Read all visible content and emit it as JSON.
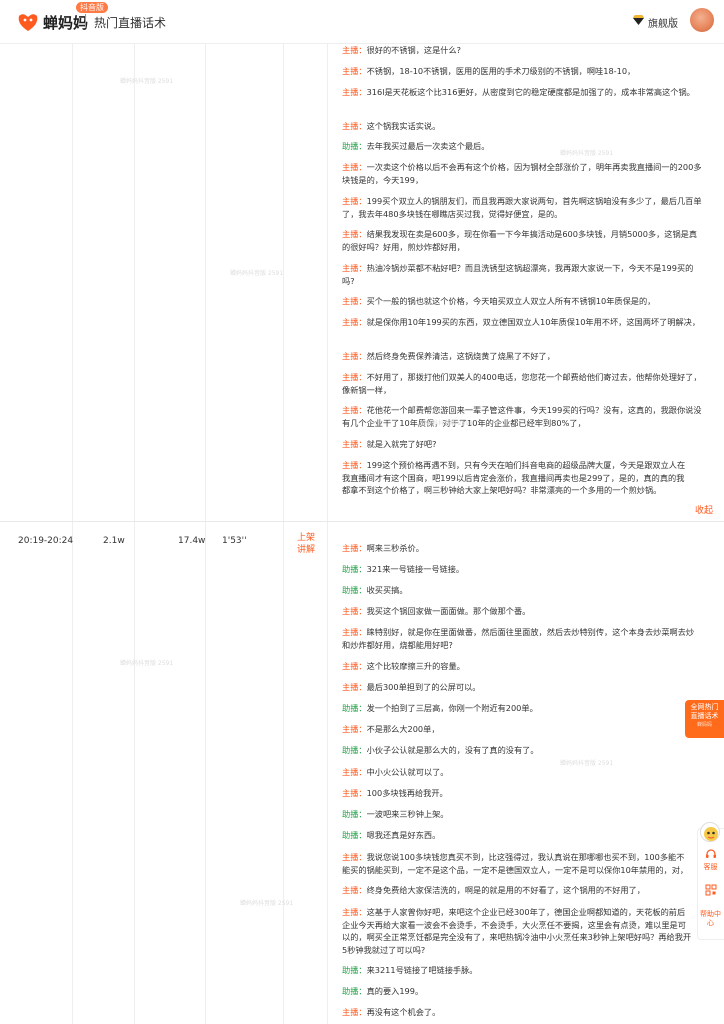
{
  "header": {
    "brand": "蝉妈妈",
    "badge": "抖音版",
    "title": "热门直播话术",
    "vip": "旗舰版",
    "vip_caret": "›"
  },
  "rows": [
    {
      "lines": [
        {
          "speaker": "主播：",
          "role": "host",
          "text": "很好的不锈钢，这是什么?"
        },
        {
          "speaker": "主播：",
          "role": "host",
          "text": "不锈钢，18-10不锈钢，医用的医用的手术刀级别的不锈钢，啊哇18-10，"
        },
        {
          "speaker": "主播：",
          "role": "host",
          "text": "316l是天花板这个比316更好，从密度到它的稳定硬度都是加强了的，成本非常高这个锅。"
        },
        {
          "speaker": "主播：",
          "role": "host",
          "text": "这个锅我实话实说。"
        },
        {
          "speaker": "助播：",
          "role": "assistant",
          "text": "去年我买过最后一次卖这个最后。"
        },
        {
          "speaker": "主播：",
          "role": "host",
          "text": "一次卖这个价格以后不会再有这个价格，因为钢材全部涨价了，明年再卖我直播间一的200多块钱是的，今天199，"
        },
        {
          "speaker": "主播：",
          "role": "host",
          "text": "199买个双立人的锅朋友们，而且我再跟大家说两句，首先啊这锅咱没有多少了，最后几百单了，我去年480多块钱在哪瞧店买过我，觉得好便宜，是的。"
        },
        {
          "speaker": "主播：",
          "role": "host",
          "text": "结果我发现在卖是600多，现在你看一下今年搞活动是600多块钱，月销5000多，这锅是真的很好吗？好用，煎炒炸都好用，"
        },
        {
          "speaker": "主播：",
          "role": "host",
          "text": "热油冷锅炒菜都不粘好吧？而且洗锈型这锅超漂亮，我再跟大家说一下，今天不是199买的吗?"
        },
        {
          "speaker": "主播：",
          "role": "host",
          "text": "买个一般的锅也就这个价格，今天咱买双立人双立人所有不锈钢10年质保是的，"
        },
        {
          "speaker": "主播：",
          "role": "host",
          "text": "就是保你用10年199买的东西，双立德国双立人10年质保10年用不坏，这国两坏了明解决，"
        },
        {
          "speaker": "主播：",
          "role": "host",
          "text": "然后终身免费保养清洁，这锅烧黄了烧黑了不好了，"
        },
        {
          "speaker": "主播：",
          "role": "host",
          "text": "不好用了，那拨打他们双美人的400电话，您您花一个邮费给他们寄过去，他帮你处理好了，像新锅一样，"
        },
        {
          "speaker": "主播：",
          "role": "host",
          "text": "花他花一个邮费帮您游回来一辈子管这件事，今天199买的行吗？没有，这真的，我跟你说没有几个企业干了10年质保，对于了10年的企业都已经牢到80%了，"
        },
        {
          "speaker": "主播：",
          "role": "host",
          "text": "就是入就完了好吧?"
        },
        {
          "speaker": "主播：",
          "role": "host",
          "text": "199这个预价格再遇不到，只有今天在咱们抖音电商的超级品牌大厦，今天是跟双立人在我直播间才有这个国商，吧199以后肯定会涨价，我直播间再卖也是299了，是的，真的真的我都拿不到这个价格了，啊三秒钟给大家上架吧好吗？非常漂亮的一个多用的一个煎炒锅。"
        }
      ],
      "collapse_label": "收起"
    },
    {
      "time": "20:19-20:24",
      "c1": "2.1w",
      "c2": "17.4w",
      "duration": "1'53''",
      "action": "上架讲解",
      "lines": [
        {
          "speaker": "主播：",
          "role": "host",
          "text": "啊来三秒杀价。"
        },
        {
          "speaker": "助播：",
          "role": "assistant",
          "text": "321来一号链接一号链接。"
        },
        {
          "speaker": "助播：",
          "role": "assistant",
          "text": "收买买搞。"
        },
        {
          "speaker": "主播：",
          "role": "host",
          "text": "我买这个锅回家做一面面做。那个做那个番。"
        },
        {
          "speaker": "主播：",
          "role": "host",
          "text": "睐特别好，就是你在里面做番，然后面往里面放，然后去炒特别传，这个本身去炒菜啊去炒和炒炸都好用，烧都能用好吧?"
        },
        {
          "speaker": "主播：",
          "role": "host",
          "text": "这个比较摩擦三升的容量。"
        },
        {
          "speaker": "主播：",
          "role": "host",
          "text": "最后300单担到了的公屏可以。"
        },
        {
          "speaker": "助播：",
          "role": "assistant",
          "text": "发一个拍到了三层高，你刚一个附近有200单。"
        },
        {
          "speaker": "主播：",
          "role": "host",
          "text": "不是那么大200单，"
        },
        {
          "speaker": "助播：",
          "role": "assistant",
          "text": "小伙子公认就是那么大的，没有了真的没有了。"
        },
        {
          "speaker": "主播：",
          "role": "host",
          "text": "中小火公认就可以了。"
        },
        {
          "speaker": "主播：",
          "role": "host",
          "text": "100多块钱再给我开。"
        },
        {
          "speaker": "助播：",
          "role": "assistant",
          "text": "一波吧来三秒钟上架。"
        },
        {
          "speaker": "助播：",
          "role": "assistant",
          "text": "嗯我还真是好东西。"
        },
        {
          "speaker": "主播：",
          "role": "host",
          "text": "我说您说100多块钱您真买不到，比这强得过，我认真说在那哪哪也买不到，100多能不能买的锅能买到，一定不是这个品，一定不是德国双立人，一定不是可以保你10年禁用的，对，"
        },
        {
          "speaker": "主播：",
          "role": "host",
          "text": "终身免费给大家保洁洗的，啊是的就是用的不好看了，这个锅用的不好用了，"
        },
        {
          "speaker": "主播：",
          "role": "host",
          "text": "这基于人家曾你好吧，来吧这个企业已经300年了，德国企业啊都知道的，天花板的前后企业今天再给大家看一波会不会烫手，不会烫手，大火烹任不要揭，这里会有点烫，难以里是可以的，啊买全正常烹饪都是完全没有了，来吧热锅冷油中小火烹任来3秒钟上架吧好吗？再给我开5秒钟我就过了可以吗?"
        },
        {
          "speaker": "助播：",
          "role": "assistant",
          "text": "来3211号链接了吧链接手脉。"
        },
        {
          "speaker": "助播：",
          "role": "assistant",
          "text": "真的要入199。"
        },
        {
          "speaker": "主播：",
          "role": "host",
          "text": "再没有这个机会了。"
        }
      ]
    }
  ],
  "promo": {
    "line1": "全网热门",
    "line2": "直播话术",
    "line3": "蝉妈妈"
  },
  "side": {
    "vip_label": "客服",
    "help_label": "帮助中心"
  },
  "watermark": "蝉妈妈抖音版 2591"
}
